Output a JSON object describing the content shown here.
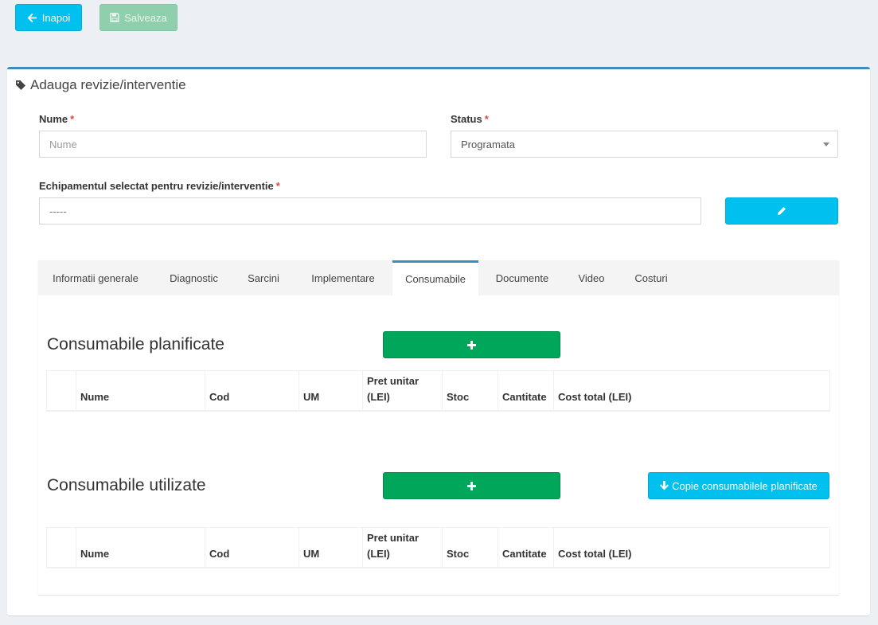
{
  "toolbar": {
    "back_label": "Inapoi",
    "save_label": "Salveaza"
  },
  "form": {
    "title": "Adauga revizie/interventie",
    "nume_label": "Nume",
    "required_mark": "*",
    "nume_placeholder": "Nume",
    "status_label": "Status",
    "status_value": "Programata",
    "equipment_label": "Echipamentul selectat pentru revizie/interventie",
    "equipment_value": "-----"
  },
  "tabs": [
    {
      "label": "Informatii generale",
      "active": false
    },
    {
      "label": "Diagnostic",
      "active": false
    },
    {
      "label": "Sarcini",
      "active": false
    },
    {
      "label": "Implementare",
      "active": false
    },
    {
      "label": "Consumabile",
      "active": true
    },
    {
      "label": "Documente",
      "active": false
    },
    {
      "label": "Video",
      "active": false
    },
    {
      "label": "Costuri",
      "active": false
    }
  ],
  "planned": {
    "title": "Consumabile planificate",
    "columns": [
      "",
      "Nume",
      "Cod",
      "UM",
      "Pret unitar (LEI)",
      "Stoc",
      "Cantitate",
      "Cost total (LEI)"
    ]
  },
  "used": {
    "title": "Consumabile utilizate",
    "copy_label": "Copie consumabilele planificate",
    "columns": [
      "",
      "Nume",
      "Cod",
      "UM",
      "Pret unitar (LEI)",
      "Stoc",
      "Cantitate",
      "Cost total (LEI)"
    ]
  },
  "colors": {
    "info": "#00c0ef",
    "success": "#00a65a",
    "primary": "#3c8dbc",
    "danger": "#dd4b39"
  }
}
